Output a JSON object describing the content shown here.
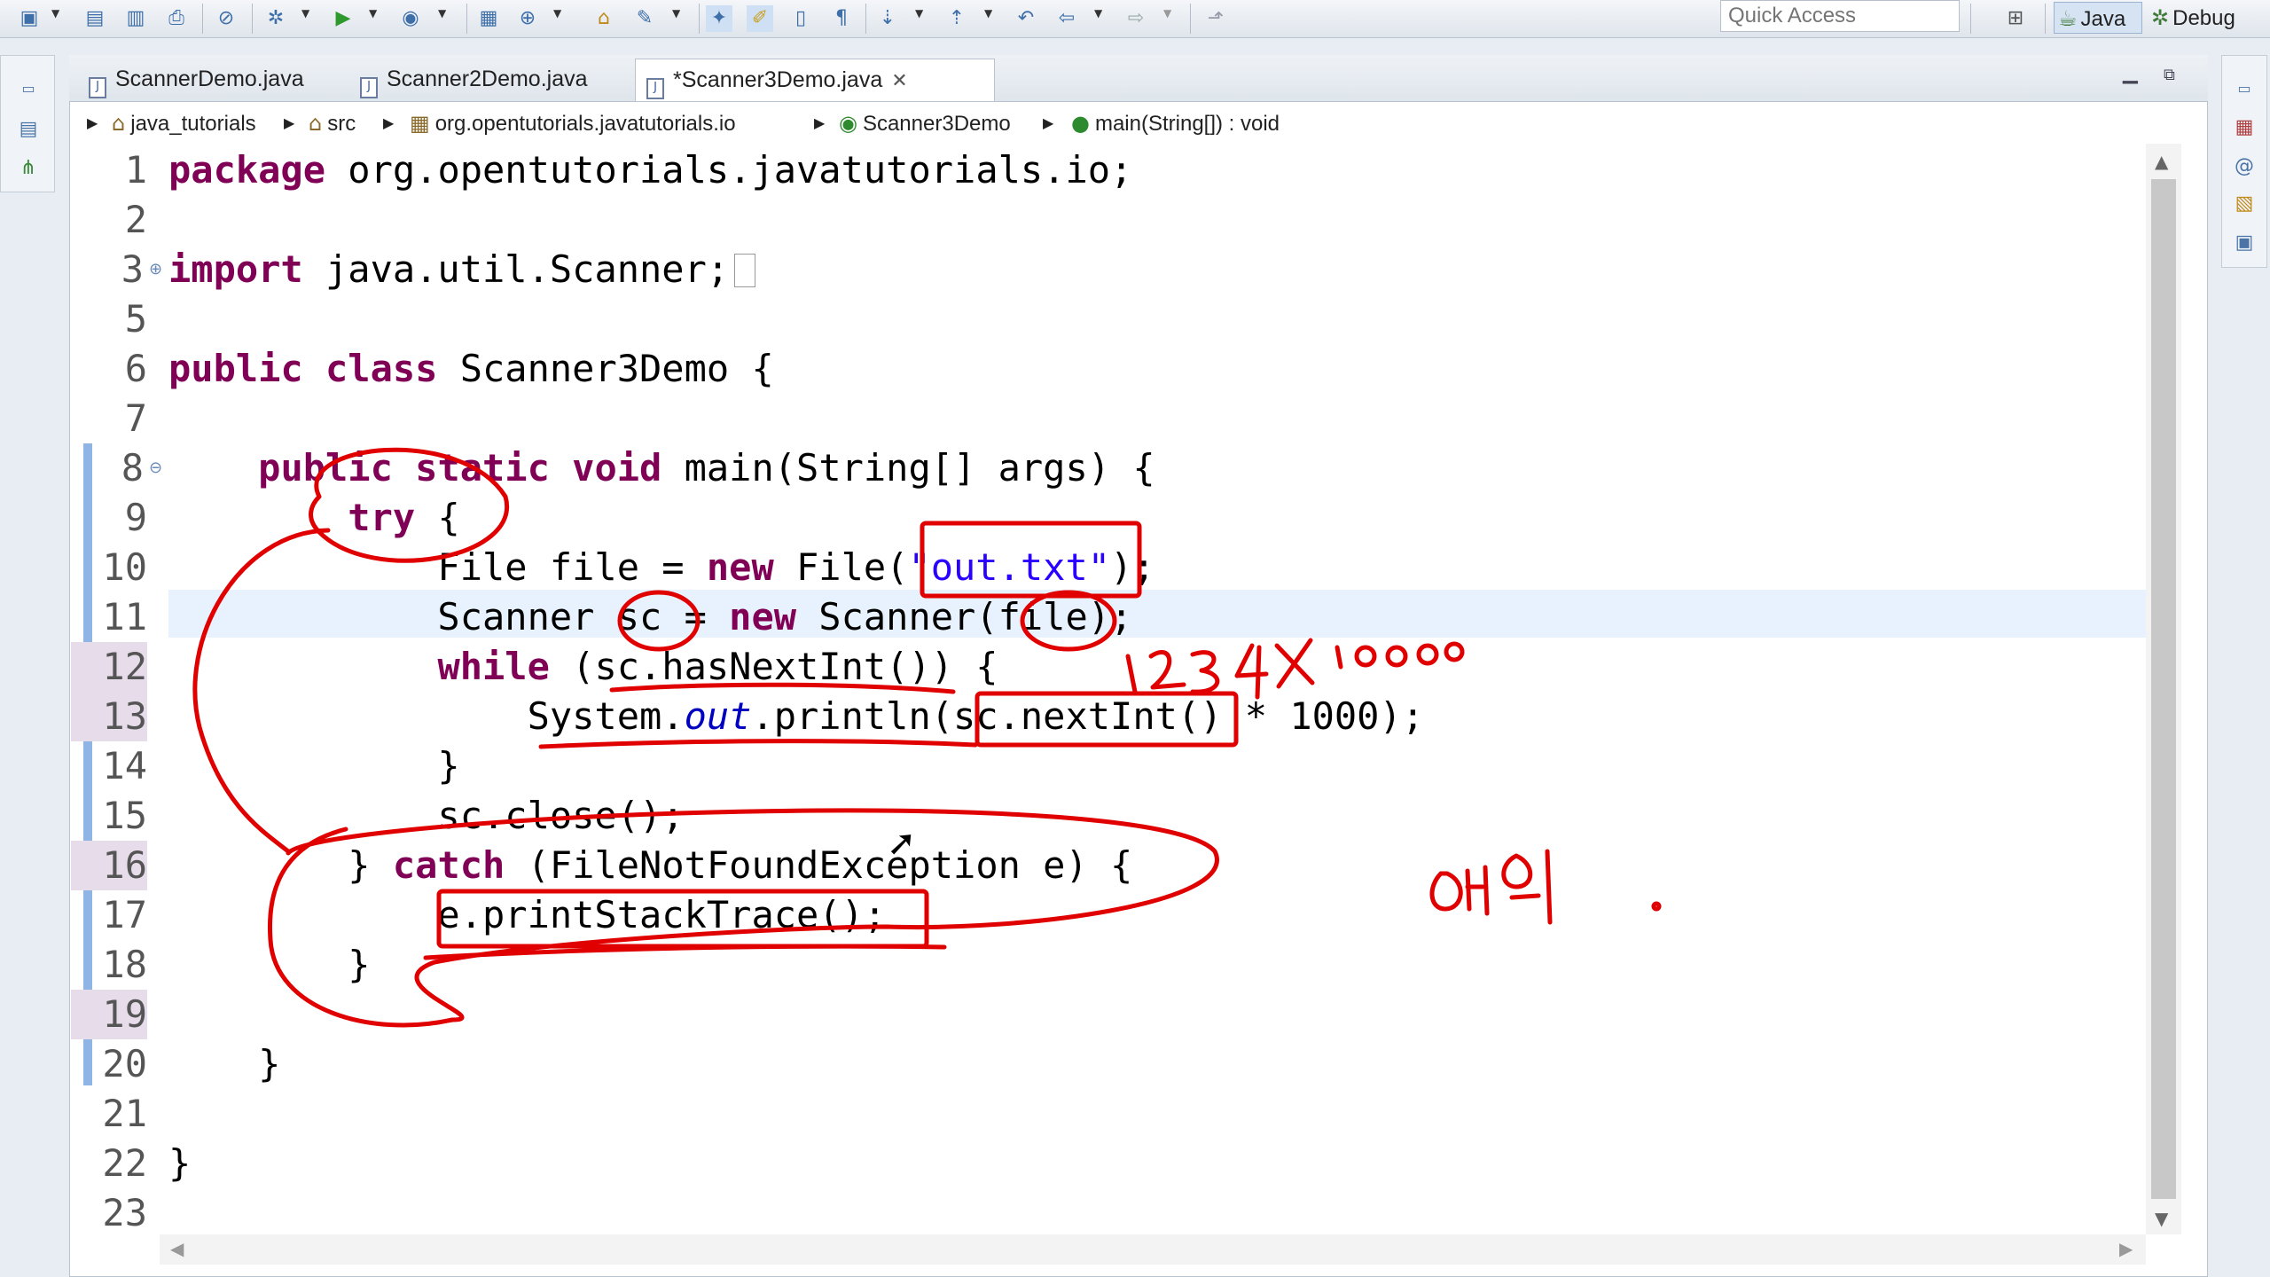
{
  "toolbar": {
    "quick_access_placeholder": "Quick Access",
    "perspectives": [
      {
        "label": "Java",
        "icon": "java-perspective-icon",
        "active": true
      },
      {
        "label": "Debug",
        "icon": "debug-perspective-icon",
        "active": false
      }
    ]
  },
  "editor": {
    "tabs": [
      {
        "label": "ScannerDemo.java",
        "active": false
      },
      {
        "label": "Scanner2Demo.java",
        "active": false
      },
      {
        "label": "*Scanner3Demo.java",
        "active": true
      }
    ],
    "breadcrumb": [
      "java_tutorials",
      "src",
      "org.opentutorials.javatutorials.io",
      "Scanner3Demo",
      "main(String[]) : void"
    ],
    "line_numbers": [
      "1",
      "2",
      "3",
      "5",
      "6",
      "7",
      "8",
      "9",
      "10",
      "11",
      "12",
      "13",
      "14",
      "15",
      "16",
      "17",
      "18",
      "19",
      "20",
      "21",
      "22",
      "23"
    ],
    "current_line": "11"
  },
  "annotations": {
    "handwritten_number": "1234X1000",
    "handwritten_korean": "예외."
  },
  "colors": {
    "keyword": "#7f0055",
    "string": "#2a00ff",
    "field": "#0000c0",
    "annotation_ink": "#e00000",
    "current_line_bg": "#e8f2fe"
  }
}
